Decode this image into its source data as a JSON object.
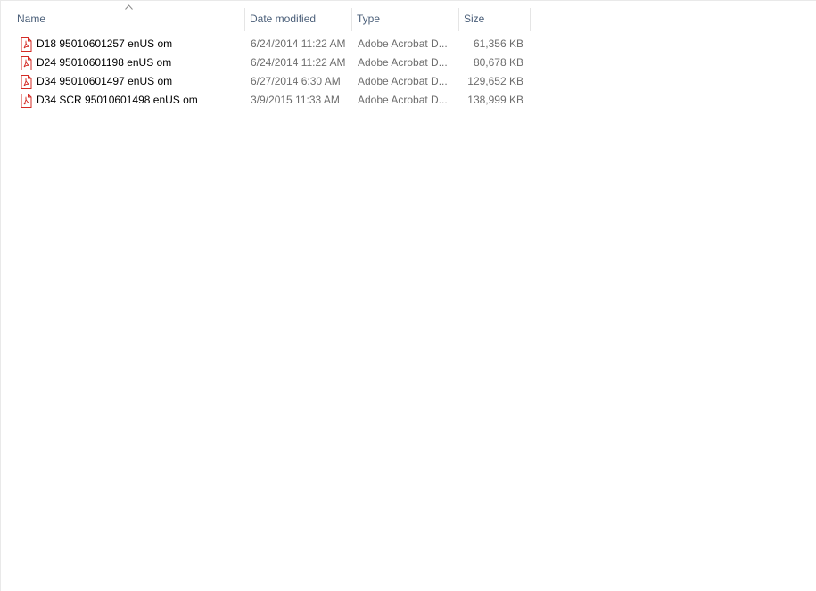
{
  "columns": {
    "name": "Name",
    "date": "Date modified",
    "type": "Type",
    "size": "Size"
  },
  "sort": {
    "column": "name",
    "direction": "ascending",
    "icon": "sort-up-chevron-icon"
  },
  "file_icon": "pdf-icon",
  "colors": {
    "header_text": "#4c607a",
    "secondary_text": "#6d6d6d",
    "pdf_icon": "#d42b25"
  },
  "files": [
    {
      "name": "D18 95010601257 enUS om",
      "date": "6/24/2014 11:22 AM",
      "type": "Adobe Acrobat D...",
      "size": "61,356 KB"
    },
    {
      "name": "D24 95010601198 enUS om",
      "date": "6/24/2014 11:22 AM",
      "type": "Adobe Acrobat D...",
      "size": "80,678 KB"
    },
    {
      "name": "D34 95010601497 enUS om",
      "date": "6/27/2014 6:30 AM",
      "type": "Adobe Acrobat D...",
      "size": "129,652 KB"
    },
    {
      "name": "D34 SCR 95010601498 enUS om",
      "date": "3/9/2015 11:33 AM",
      "type": "Adobe Acrobat D...",
      "size": "138,999 KB"
    }
  ]
}
